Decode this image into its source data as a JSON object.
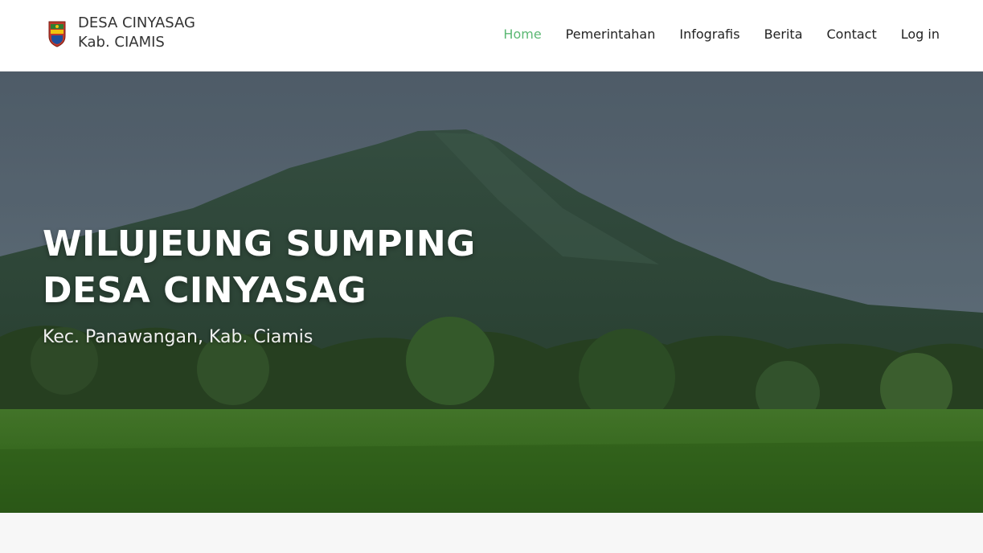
{
  "brand": {
    "line1": "DESA CINYASAG",
    "line2": "Kab. CIAMIS",
    "logo_icon": "village-crest-icon"
  },
  "nav": {
    "items": [
      {
        "label": "Home",
        "active": true
      },
      {
        "label": "Pemerintahan",
        "active": false
      },
      {
        "label": "Infografis",
        "active": false
      },
      {
        "label": "Berita",
        "active": false
      },
      {
        "label": "Contact",
        "active": false
      },
      {
        "label": "Log in",
        "active": false
      }
    ]
  },
  "hero": {
    "title_line1": "WILUJEUNG SUMPING",
    "title_line2": "DESA CINYASAG",
    "subtitle": "Kec. Panawangan, Kab. Ciamis"
  },
  "colors": {
    "accent": "#5cb874",
    "nav_text": "#222222",
    "hero_text": "#ffffff"
  }
}
